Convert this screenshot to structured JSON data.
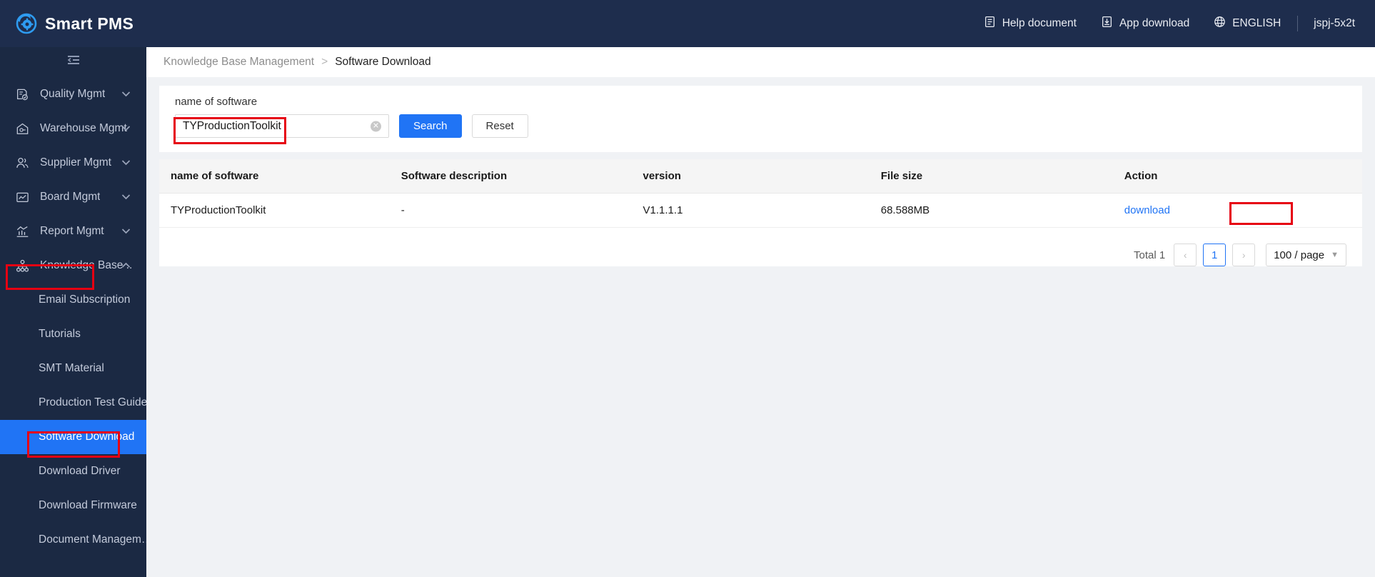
{
  "app": {
    "brand": "Smart PMS",
    "logo_icon": "gear-circle-logo",
    "accent_color": "#2074f5",
    "header_bg": "#1e2d4d",
    "sidebar_bg": "#1b2943",
    "annotation_color": "#e60012"
  },
  "header": {
    "items": [
      {
        "label": "Help document",
        "icon": "document-icon"
      },
      {
        "label": "App download",
        "icon": "app-download-icon"
      },
      {
        "label": "ENGLISH",
        "icon": "globe-icon"
      }
    ],
    "user": "jspj-5x2t"
  },
  "sidebar": {
    "collapse_icon": "menu-fold-icon",
    "menu": [
      {
        "label": "Quality Mgmt",
        "icon": "clipboard-check-icon",
        "arrow": "chevron-down-icon"
      },
      {
        "label": "Warehouse Mgmt",
        "icon": "warehouse-icon",
        "arrow": "chevron-down-icon"
      },
      {
        "label": "Supplier Mgmt",
        "icon": "users-icon",
        "arrow": "chevron-down-icon"
      },
      {
        "label": "Board Mgmt",
        "icon": "monitor-chart-icon",
        "arrow": "chevron-down-icon"
      },
      {
        "label": "Report Mgmt",
        "icon": "bar-chart-icon",
        "arrow": "chevron-down-icon"
      },
      {
        "label": "Knowledge Base ..",
        "icon": "org-tree-icon",
        "arrow": "chevron-up-icon"
      }
    ],
    "submenu": [
      {
        "label": "Email Subscription",
        "active": false
      },
      {
        "label": "Tutorials",
        "active": false
      },
      {
        "label": "SMT Material",
        "active": false
      },
      {
        "label": "Production Test Guide",
        "active": false
      },
      {
        "label": "Software Download",
        "active": true
      },
      {
        "label": "Download Driver",
        "active": false
      },
      {
        "label": "Download Firmware",
        "active": false
      },
      {
        "label": "Document Managem…",
        "active": false
      }
    ]
  },
  "breadcrumb": {
    "parent": "Knowledge Base Management",
    "separator": ">",
    "current": "Software Download"
  },
  "filter": {
    "label": "name of software",
    "input_value": "TYProductionToolkit",
    "input_placeholder": "",
    "clear_icon": "clear-circle-icon",
    "search_button": "Search",
    "reset_button": "Reset"
  },
  "table": {
    "columns": [
      "name of software",
      "Software description",
      "version",
      "File size",
      "Action"
    ],
    "rows": [
      {
        "name": "TYProductionToolkit",
        "description": "-",
        "version": "V1.1.1.1",
        "file_size": "68.588MB",
        "action": "download"
      }
    ]
  },
  "pagination": {
    "total": "Total 1",
    "prev_icon": "chevron-left-icon",
    "current_page": "1",
    "next_icon": "chevron-right-icon",
    "page_size": "100 / page",
    "page_size_chevron": "chevron-down-icon"
  }
}
